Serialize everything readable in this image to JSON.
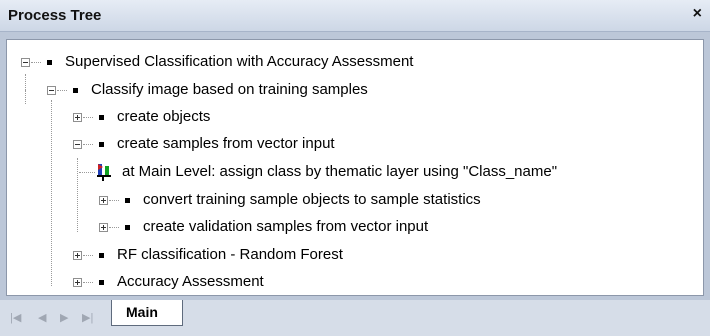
{
  "panel": {
    "title": "Process Tree",
    "close_label": "×"
  },
  "tree": {
    "items": [
      {
        "label": "Supervised Classification with Accuracy Assessment",
        "expander": "-"
      },
      {
        "label": "Classify image based on training samples",
        "expander": "-"
      },
      {
        "label": "create objects",
        "expander": "+"
      },
      {
        "label": "create samples from vector input",
        "expander": "-"
      },
      {
        "label": "at  Main Level: assign class by thematic layer using \"Class_name\"",
        "expander": ""
      },
      {
        "label": "convert training sample objects to sample statistics",
        "expander": "+"
      },
      {
        "label": "create validation samples from vector input",
        "expander": "+"
      },
      {
        "label": "RF classification - Random Forest",
        "expander": "+"
      },
      {
        "label": "Accuracy Assessment",
        "expander": "+"
      }
    ]
  },
  "tabs": {
    "active": "Main"
  },
  "nav": {
    "first": "|◀",
    "prev": "◀",
    "next": "▶",
    "last": "▶|"
  }
}
